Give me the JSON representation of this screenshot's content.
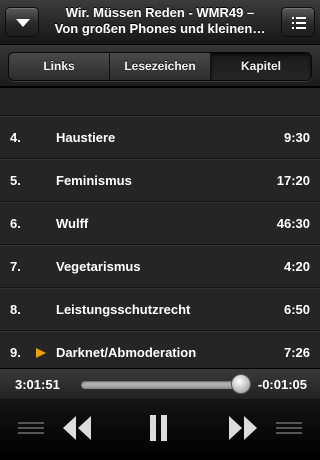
{
  "header": {
    "title_line1": "Wir. Müssen Reden - WMR49 –",
    "title_line2": "Von großen Phones und kleinen…",
    "left_button_icon": "chevron-down-icon",
    "right_button_icon": "list-icon"
  },
  "tabs": [
    {
      "label": "Links",
      "active": false
    },
    {
      "label": "Lesezeichen",
      "active": false
    },
    {
      "label": "Kapitel",
      "active": true
    }
  ],
  "chapters": [
    {
      "number": "4.",
      "title": "Haustiere",
      "duration": "9:30",
      "playing": false
    },
    {
      "number": "5.",
      "title": "Feminismus",
      "duration": "17:20",
      "playing": false
    },
    {
      "number": "6.",
      "title": "Wulff",
      "duration": "46:30",
      "playing": false
    },
    {
      "number": "7.",
      "title": "Vegetarismus",
      "duration": "4:20",
      "playing": false
    },
    {
      "number": "8.",
      "title": "Leistungsschutzrecht",
      "duration": "6:50",
      "playing": false
    },
    {
      "number": "9.",
      "title": "Darknet/Abmoderation",
      "duration": "7:26",
      "playing": true
    }
  ],
  "scrubber": {
    "elapsed": "3:01:51",
    "remaining": "-0:01:05",
    "progress": 0.99
  },
  "colors": {
    "accent": "#f0a000",
    "background": "#252525"
  },
  "controls": {
    "left_icon": "handle-lines-icon",
    "rewind_icon": "rewind-icon",
    "pause_icon": "pause-icon",
    "forward_icon": "fast-forward-icon",
    "right_icon": "handle-lines-icon"
  }
}
